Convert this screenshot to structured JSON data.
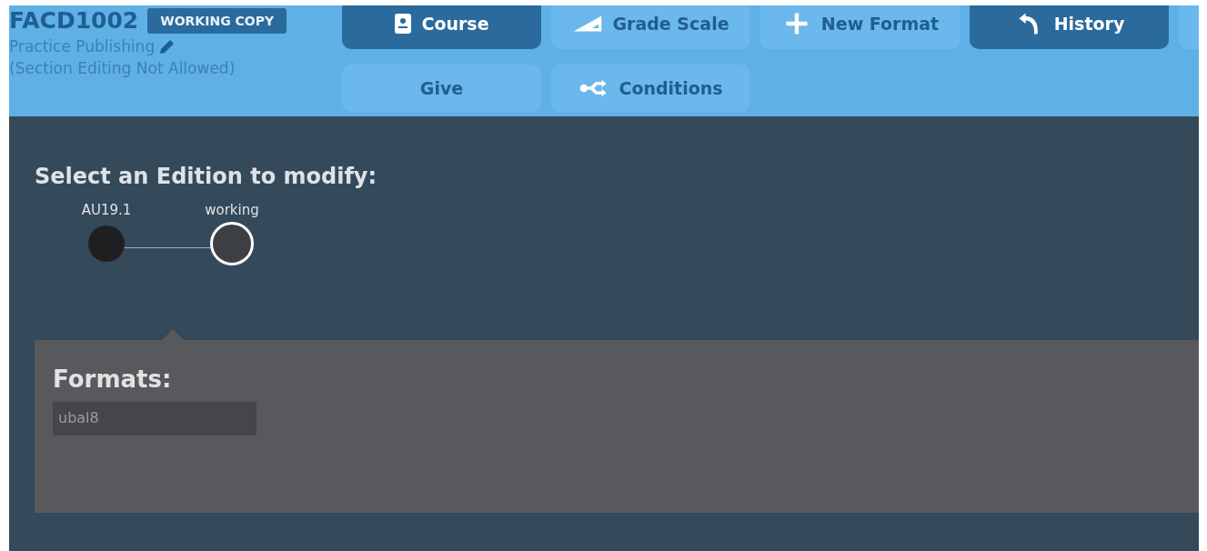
{
  "header": {
    "code": "FACD1002",
    "badge": "WORKING COPY",
    "publishing": "Practice Publishing",
    "note": "(Section Editing Not Allowed)"
  },
  "toolbar": [
    {
      "label": "Course",
      "active": true
    },
    {
      "label": "Grade Scale",
      "active": false
    },
    {
      "label": "New Format",
      "active": false
    },
    {
      "label": "History",
      "active": true
    },
    {
      "active": false
    },
    {
      "label": "Give",
      "active": false
    },
    {
      "label": "Conditions",
      "active": false
    }
  ],
  "editions": {
    "title": "Select an Edition to modify:",
    "items": [
      {
        "label": "AU19.1",
        "selected": false
      },
      {
        "label": "working",
        "selected": true
      }
    ]
  },
  "formats": {
    "title": "Formats:",
    "items": [
      "ubal8"
    ]
  }
}
